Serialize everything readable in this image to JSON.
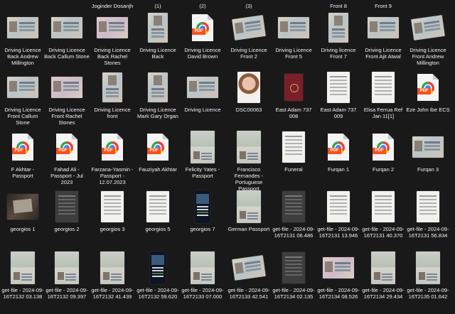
{
  "top_labels": [
    "Joginder Dosanjh",
    "(1)",
    "(2)",
    "(3)",
    "Front 8",
    "Front 9"
  ],
  "files": [
    {
      "name": "Driving Licence Back Andrew Millington",
      "icon": "licence-thumbnail-icon"
    },
    {
      "name": "Driving Licence Back Callum Stone",
      "icon": "licence-thumbnail-icon"
    },
    {
      "name": "Driving Licence Back Rachel Stones",
      "icon": "licence-thumbnail-icon"
    },
    {
      "name": "Driving Licence Back",
      "icon": "licence-thumbnail-icon"
    },
    {
      "name": "Driving Licence David Brown",
      "icon": "pdf-icon"
    },
    {
      "name": "Driving Licence Front 2",
      "icon": "licence-thumbnail-icon"
    },
    {
      "name": "Driving Licence Front 5",
      "icon": "licence-thumbnail-icon"
    },
    {
      "name": "Driving licence Front 7",
      "icon": "licence-thumbnail-icon"
    },
    {
      "name": "Driving Licence Front Ajit Atwal",
      "icon": "licence-thumbnail-icon"
    },
    {
      "name": "Driving Licence Front Andrew Millington",
      "icon": "licence-thumbnail-icon"
    },
    {
      "name": "Driving Licence Front Callum Stone",
      "icon": "licence-thumbnail-icon"
    },
    {
      "name": "Driving Licence Front Rachel Stones",
      "icon": "licence-thumbnail-icon"
    },
    {
      "name": "Driving Licence front",
      "icon": "licence-thumbnail-icon"
    },
    {
      "name": "Driving Licence Mark Gary Organ",
      "icon": "licence-thumbnail-icon"
    },
    {
      "name": "Driving Licence",
      "icon": "licence-thumbnail-icon"
    },
    {
      "name": "DSC00063",
      "icon": "portrait-thumbnail-icon"
    },
    {
      "name": "East Adam 737 008",
      "icon": "passport-cover-thumbnail-icon"
    },
    {
      "name": "East Adam 737 009",
      "icon": "document-thumbnail-icon"
    },
    {
      "name": "Elisa Ferrua Ref Jan 11[1]",
      "icon": "document-thumbnail-icon"
    },
    {
      "name": "Eze John Ibe ECS",
      "icon": "pdf-icon"
    },
    {
      "name": "F Akhtar - Passport",
      "icon": "pdf-icon"
    },
    {
      "name": "Fahad Ali - Passport - Jul 2023",
      "icon": "pdf-icon"
    },
    {
      "name": "Farzana-Yasmin - Passport - 12.07.2023",
      "icon": "pdf-icon"
    },
    {
      "name": "Fauziyah Akhtar",
      "icon": "pdf-icon"
    },
    {
      "name": "Felicity Yates - Passport",
      "icon": "passport-thumbnail-icon"
    },
    {
      "name": "Francisco Fernandes - Portuguese Passport",
      "icon": "passport-thumbnail-icon"
    },
    {
      "name": "Funeral",
      "icon": "document-thumbnail-icon"
    },
    {
      "name": "Furqan 1",
      "icon": "pdf-icon"
    },
    {
      "name": "Furqan 2",
      "icon": "pdf-icon"
    },
    {
      "name": "Furqan 3",
      "icon": "licence-thumbnail-icon"
    },
    {
      "name": "georgios 1",
      "icon": "photo-thumbnail-icon"
    },
    {
      "name": "georgios 2",
      "icon": "document-thumbnail-icon"
    },
    {
      "name": "georgios 3",
      "icon": "document-thumbnail-icon"
    },
    {
      "name": "georgios 5",
      "icon": "document-thumbnail-icon"
    },
    {
      "name": "georgios 7",
      "icon": "phone-screenshot-thumbnail-icon"
    },
    {
      "name": "German Passport",
      "icon": "passport-thumbnail-icon"
    },
    {
      "name": "get-file - 2024-09-16T2131 06.486",
      "icon": "document-thumbnail-icon"
    },
    {
      "name": "get-file - 2024-09-16T2131 13.946",
      "icon": "document-thumbnail-icon"
    },
    {
      "name": "get-file - 2024-09-16T2131 40.370",
      "icon": "document-thumbnail-icon"
    },
    {
      "name": "get-file - 2024-09-16T2131 56.834",
      "icon": "document-thumbnail-icon"
    },
    {
      "name": "get-file - 2024-09-16T2132 03.138",
      "icon": "passport-thumbnail-icon"
    },
    {
      "name": "get-file - 2024-09-16T2132 09.397",
      "icon": "passport-thumbnail-icon"
    },
    {
      "name": "get-file - 2024-09-16T2132 41.439",
      "icon": "passport-thumbnail-icon"
    },
    {
      "name": "get-file - 2024-09-16T2132 59.620",
      "icon": "phone-screenshot-thumbnail-icon"
    },
    {
      "name": "get-file - 2024-09-16T2133 07.000",
      "icon": "passport-thumbnail-icon"
    },
    {
      "name": "get-file - 2024-09-16T2133 42.541",
      "icon": "licence-thumbnail-icon"
    },
    {
      "name": "get-file - 2024-09-16T2134 02.135",
      "icon": "document-thumbnail-icon"
    },
    {
      "name": "get-file - 2024-09-16T2134 08.526",
      "icon": "licence-thumbnail-icon"
    },
    {
      "name": "get-file - 2024-09-16T2134 29.434",
      "icon": "passport-thumbnail-icon"
    },
    {
      "name": "get-file - 2024-09-16T2135 01.642",
      "icon": "passport-thumbnail-icon"
    }
  ]
}
